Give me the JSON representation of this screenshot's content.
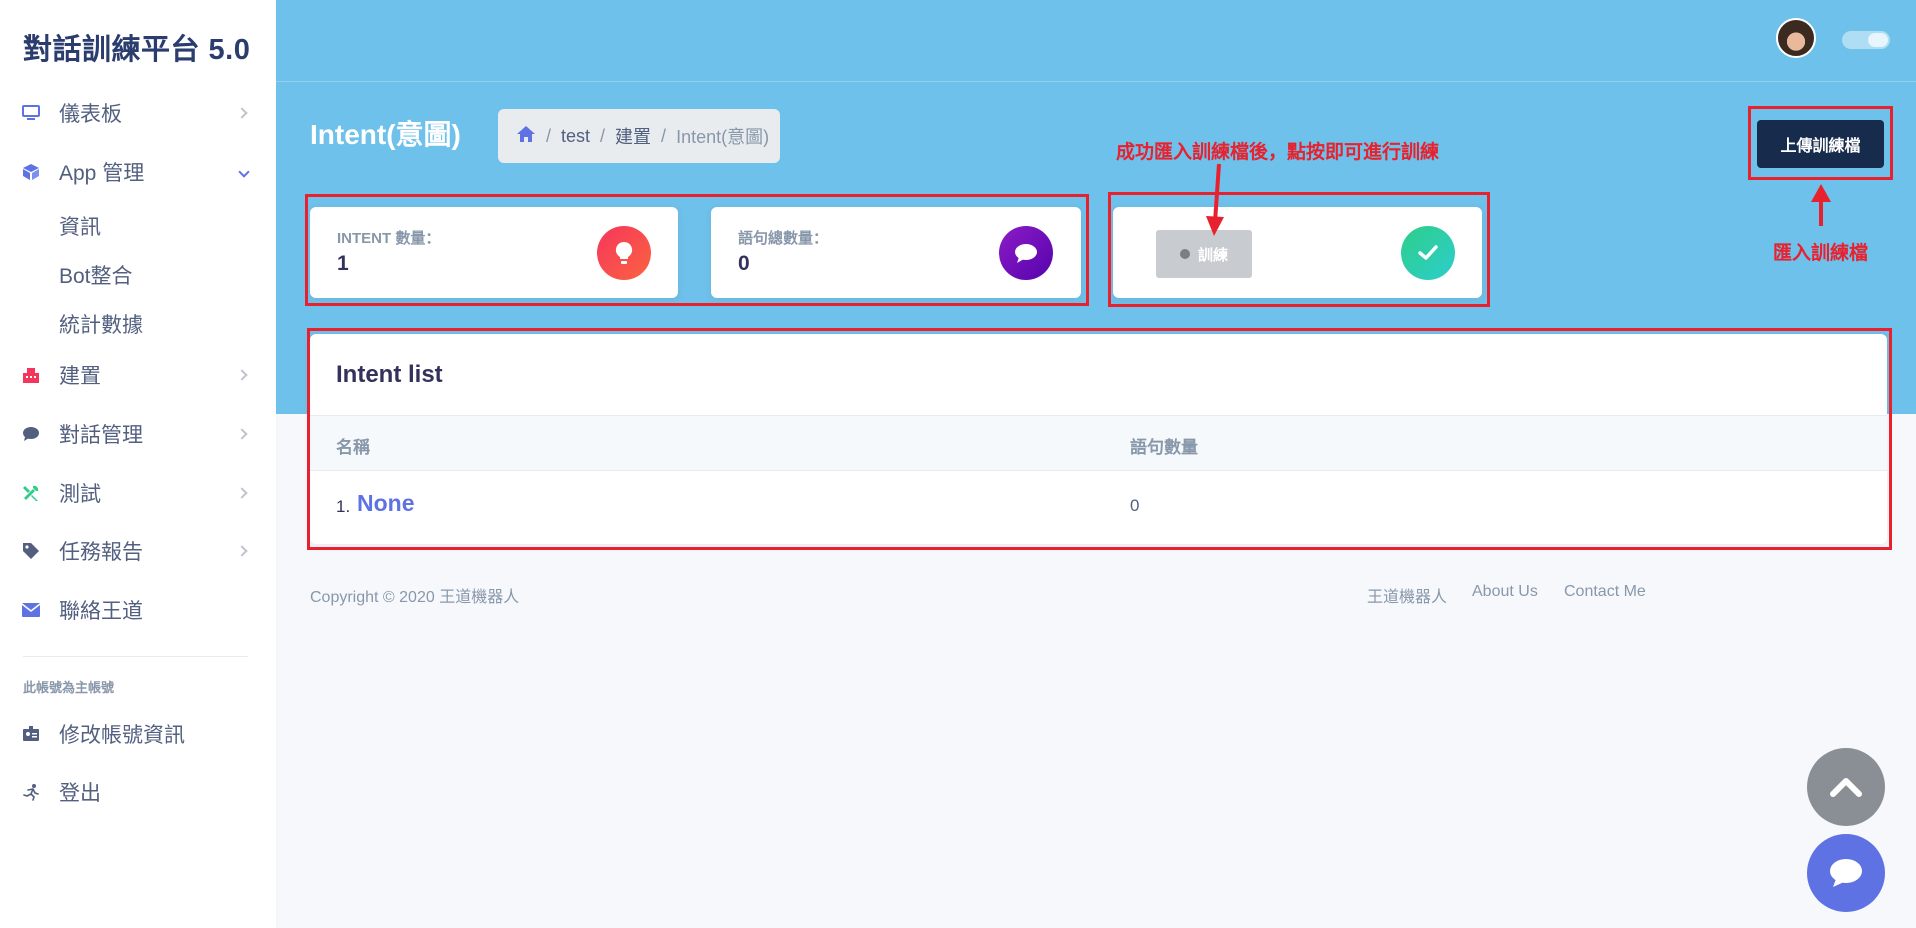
{
  "sidebar": {
    "brand": "對話訓練平台 5.0",
    "items": [
      {
        "label": "儀表板"
      },
      {
        "label": "App 管理"
      },
      {
        "label": "建置"
      },
      {
        "label": "對話管理"
      },
      {
        "label": "測試"
      },
      {
        "label": "任務報告"
      },
      {
        "label": "聯絡王道"
      }
    ],
    "app_sub_items": [
      {
        "label": "資訊"
      },
      {
        "label": "Bot整合"
      },
      {
        "label": "統計數據"
      }
    ],
    "account_heading": "此帳號為主帳號",
    "account_items": [
      {
        "label": "修改帳號資訊"
      },
      {
        "label": "登出"
      }
    ]
  },
  "header": {
    "page_title": "Intent(意圖)",
    "breadcrumb": [
      "test",
      "建置",
      "Intent(意圖)"
    ],
    "upload_button": "上傳訓練檔"
  },
  "stats": {
    "intent_count_label": "INTENT 數量：",
    "intent_count_value": "1",
    "utterance_count_label": "語句總數量：",
    "utterance_count_value": "0",
    "train_button": "訓練"
  },
  "intent_list": {
    "title": "Intent list",
    "columns": [
      "名稱",
      "語句數量"
    ],
    "rows": [
      {
        "index": "1.",
        "name": "None",
        "count": "0"
      }
    ]
  },
  "footer": {
    "copyright": "Copyright © 2020 王道機器人",
    "links": [
      "王道機器人",
      "About Us",
      "Contact Me"
    ]
  },
  "annotations": {
    "train_hint": "成功匯入訓練檔後，點按即可進行訓練",
    "upload_hint": "匯入訓練檔"
  },
  "colors": {
    "header_bg": "#6ec1ea",
    "accent": "#5e72e4",
    "annotation": "#e8212e",
    "primary_dark": "#172b4d"
  }
}
